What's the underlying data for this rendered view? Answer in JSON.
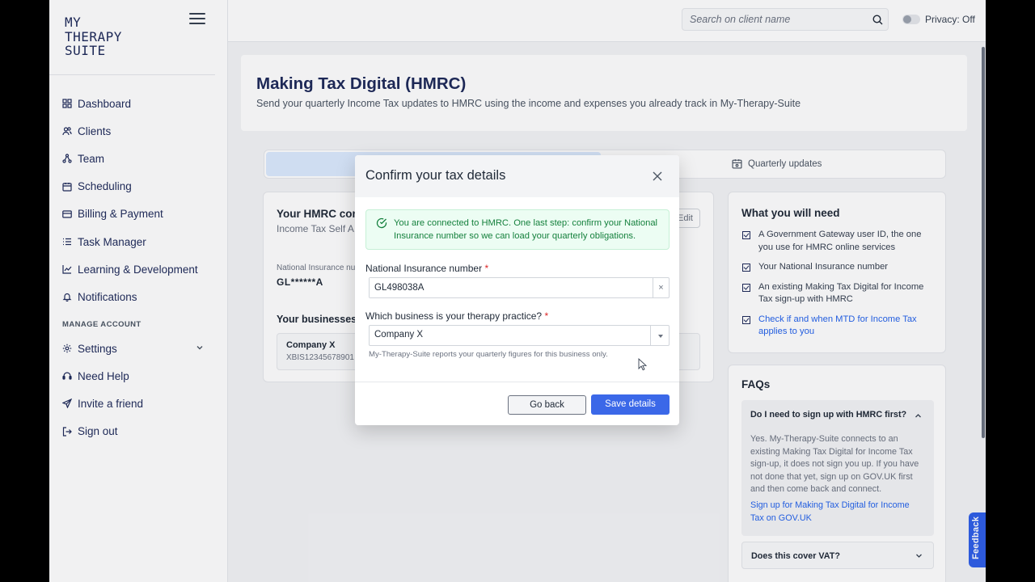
{
  "brand": {
    "logo_text": "MY\nTHERAPY\nSUITE"
  },
  "sidebar": {
    "items": [
      {
        "label": "Dashboard",
        "icon": "grid-icon"
      },
      {
        "label": "Clients",
        "icon": "users-icon"
      },
      {
        "label": "Team",
        "icon": "network-icon"
      },
      {
        "label": "Scheduling",
        "icon": "calendar-icon"
      },
      {
        "label": "Billing & Payment",
        "icon": "credit-card-icon"
      },
      {
        "label": "Task Manager",
        "icon": "list-icon"
      },
      {
        "label": "Learning & Development",
        "icon": "chart-line-icon"
      },
      {
        "label": "Notifications",
        "icon": "bell-icon"
      }
    ],
    "section_label": "MANAGE ACCOUNT",
    "account_items": [
      {
        "label": "Settings",
        "icon": "gear-icon"
      },
      {
        "label": "Need Help",
        "icon": "help-icon"
      },
      {
        "label": "Invite a friend",
        "icon": "send-icon"
      },
      {
        "label": "Sign out",
        "icon": "sign-out-icon"
      }
    ]
  },
  "topbar": {
    "search_placeholder": "Search on client name",
    "privacy_label": "Privacy: Off"
  },
  "page": {
    "title": "Making Tax Digital (HMRC)",
    "subtitle": "Send your quarterly Income Tax updates to HMRC using the income and expenses you already track in My-Therapy-Suite"
  },
  "tabs": {
    "quarterly": "Quarterly updates"
  },
  "connection": {
    "title": "Your HMRC con",
    "subtitle": "Income Tax Self A",
    "edit_label": "Edit",
    "ni_label": "National Insurance nu",
    "ni_value": "GL******A",
    "businesses_heading": "Your businesses a",
    "business_name": "Company X",
    "business_id": "XBIS12345678901"
  },
  "need": {
    "title": "What you will need",
    "items": [
      "A Government Gateway user ID, the one you use for HMRC online services",
      "Your National Insurance number",
      "An existing Making Tax Digital for Income Tax sign-up with HMRC",
      "Check if and when MTD for Income Tax applies to you"
    ]
  },
  "faq": {
    "title": "FAQs",
    "q1": "Do I need to sign up with HMRC first?",
    "a1": "Yes. My-Therapy-Suite connects to an existing Making Tax Digital for Income Tax sign-up, it does not sign you up. If you have not done that yet, sign up on GOV.UK first and then come back and connect.",
    "a1_link": "Sign up for Making Tax Digital for Income Tax on GOV.UK",
    "q2": "Does this cover VAT?"
  },
  "feedback_label": "Feedback",
  "modal": {
    "title": "Confirm your tax details",
    "alert": "You are connected to HMRC. One last step: confirm your National Insurance number so we can load your quarterly obligations.",
    "ni_label": "National Insurance number",
    "ni_value": "GL498038A",
    "clear_symbol": "×",
    "required_mark": "*",
    "business_label": "Which business is your therapy practice?",
    "business_value": "Company X",
    "business_help": "My-Therapy-Suite reports your quarterly figures for this business only.",
    "back_label": "Go back",
    "save_label": "Save details"
  },
  "colors": {
    "primary": "#3b68e8",
    "navy": "#1e2a5a",
    "success_bg": "#ecfdf3",
    "success_text": "#15803d"
  }
}
